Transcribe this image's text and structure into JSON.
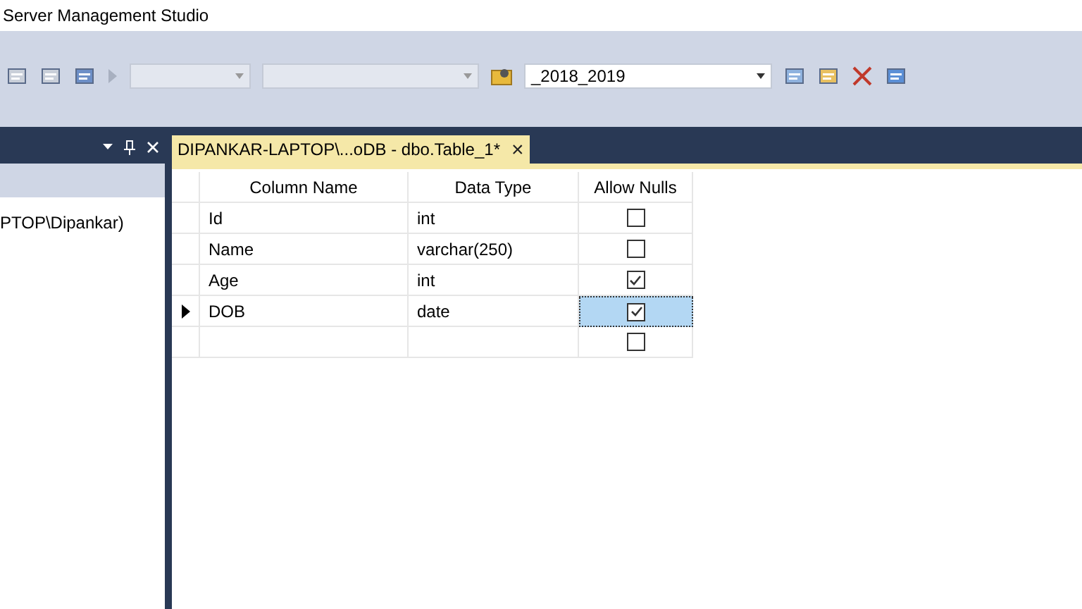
{
  "window": {
    "title": "Server Management Studio"
  },
  "toolbar": {
    "database": "_2018_2019"
  },
  "object_explorer": {
    "node": "PTOP\\Dipankar)"
  },
  "tab": {
    "title": "DIPANKAR-LAPTOP\\...oDB - dbo.Table_1*",
    "close": "×",
    "selected": true
  },
  "table": {
    "columns": [
      "Column Name",
      "Data Type",
      "Allow Nulls"
    ],
    "rows": [
      {
        "kind": "column",
        "name": "Id",
        "type": "int",
        "allow_nulls": false,
        "selected": false
      },
      {
        "kind": "column",
        "name": "Name",
        "type": "varchar(250)",
        "allow_nulls": false,
        "selected": false
      },
      {
        "kind": "column",
        "name": "Age",
        "type": "int",
        "allow_nulls": true,
        "selected": false
      },
      {
        "kind": "column",
        "name": "DOB",
        "type": "date",
        "allow_nulls": true,
        "selected": true
      },
      {
        "kind": "new",
        "allow_nulls": false,
        "selected": false
      }
    ]
  }
}
